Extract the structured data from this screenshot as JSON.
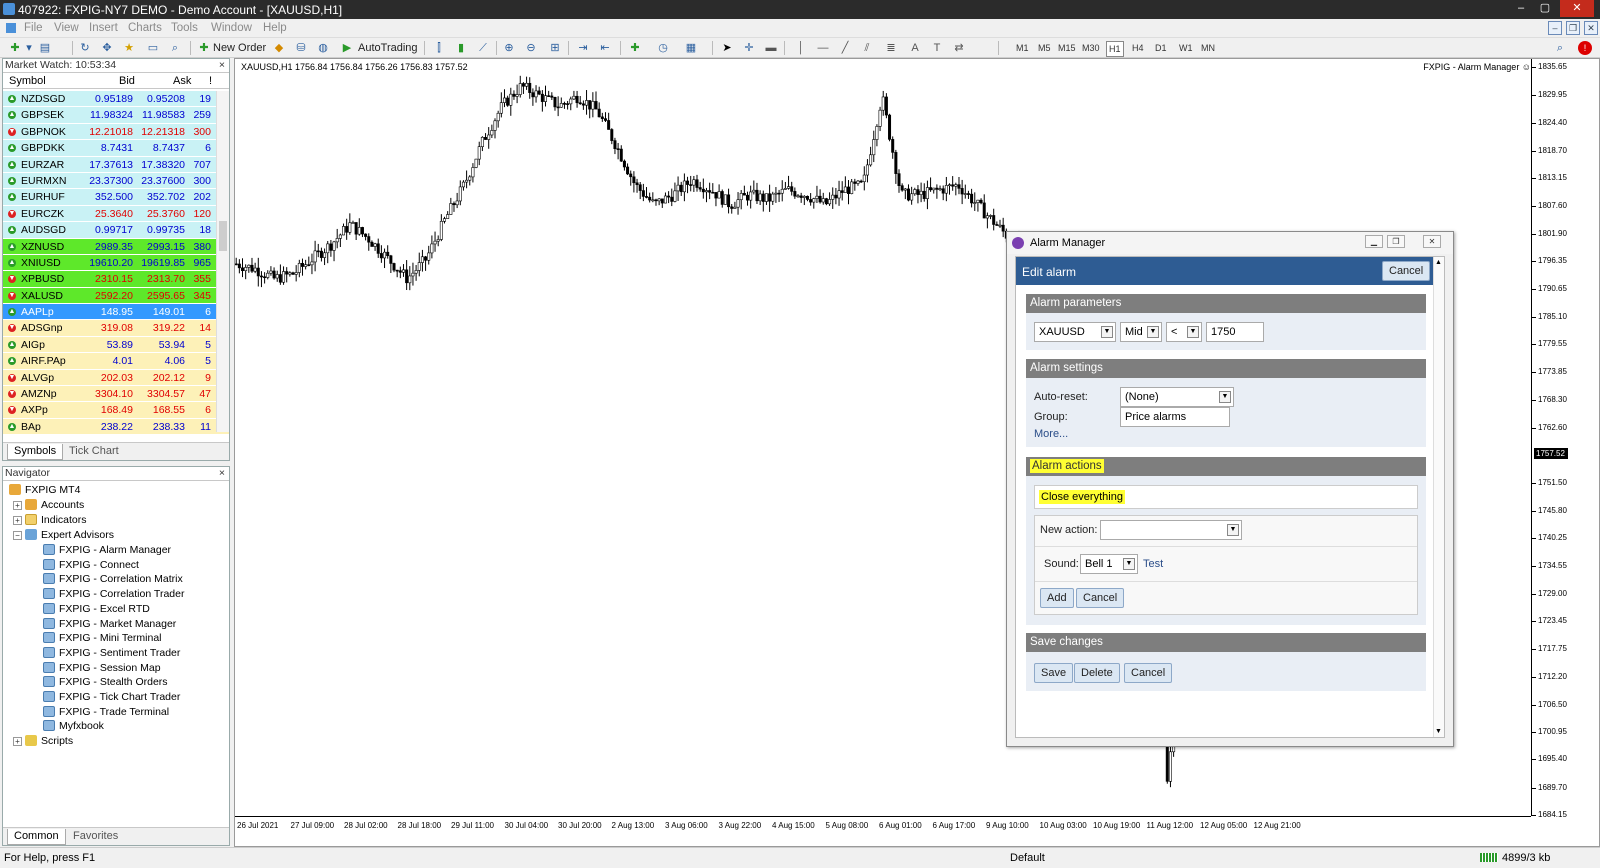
{
  "window": {
    "title": "407922: FXPIG-NY7 DEMO - Demo Account - [XAUUSD,H1]",
    "controls": [
      "–",
      "▢",
      "✕"
    ]
  },
  "menu": [
    "File",
    "View",
    "Insert",
    "Charts",
    "Tools",
    "Window",
    "Help"
  ],
  "toolbar": {
    "new_order": "New Order",
    "auto_trading": "AutoTrading",
    "timeframes": [
      "M1",
      "M5",
      "M15",
      "M30",
      "H1",
      "H4",
      "D1",
      "W1",
      "MN"
    ],
    "active_timeframe": "H1"
  },
  "market_watch": {
    "title": "Market Watch: 10:53:34",
    "columns": {
      "symbol": "Symbol",
      "bid": "Bid",
      "ask": "Ask",
      "spread": "!"
    },
    "rows": [
      {
        "symbol": "NZDSGD",
        "bid": "0.95189",
        "ask": "0.95208",
        "spread": "19",
        "bg": "#c9f2f5",
        "color": "#0000d0",
        "dir": "up"
      },
      {
        "symbol": "GBPSEK",
        "bid": "11.98324",
        "ask": "11.98583",
        "spread": "259",
        "bg": "#c9f2f5",
        "color": "#0000d0",
        "dir": "up"
      },
      {
        "symbol": "GBPNOK",
        "bid": "12.21018",
        "ask": "12.21318",
        "spread": "300",
        "bg": "#c9f2f5",
        "color": "#e00000",
        "dir": "down"
      },
      {
        "symbol": "GBPDKK",
        "bid": "8.7431",
        "ask": "8.7437",
        "spread": "6",
        "bg": "#c9f2f5",
        "color": "#0000d0",
        "dir": "up"
      },
      {
        "symbol": "EURZAR",
        "bid": "17.37613",
        "ask": "17.38320",
        "spread": "707",
        "bg": "#c9f2f5",
        "color": "#0000d0",
        "dir": "up"
      },
      {
        "symbol": "EURMXN",
        "bid": "23.37300",
        "ask": "23.37600",
        "spread": "300",
        "bg": "#c9f2f5",
        "color": "#0000d0",
        "dir": "up"
      },
      {
        "symbol": "EURHUF",
        "bid": "352.500",
        "ask": "352.702",
        "spread": "202",
        "bg": "#c9f2f5",
        "color": "#0000d0",
        "dir": "up"
      },
      {
        "symbol": "EURCZK",
        "bid": "25.3640",
        "ask": "25.3760",
        "spread": "120",
        "bg": "#c9f2f5",
        "color": "#e00000",
        "dir": "down"
      },
      {
        "symbol": "AUDSGD",
        "bid": "0.99717",
        "ask": "0.99735",
        "spread": "18",
        "bg": "#c9f2f5",
        "color": "#0000d0",
        "dir": "up"
      },
      {
        "symbol": "XZNUSD",
        "bid": "2989.35",
        "ask": "2993.15",
        "spread": "380",
        "bg": "#5ee82a",
        "color": "#0000d0",
        "dir": "up"
      },
      {
        "symbol": "XNIUSD",
        "bid": "19610.20",
        "ask": "19619.85",
        "spread": "965",
        "bg": "#5ee82a",
        "color": "#0000d0",
        "dir": "up"
      },
      {
        "symbol": "XPBUSD",
        "bid": "2310.15",
        "ask": "2313.70",
        "spread": "355",
        "bg": "#5ee82a",
        "color": "#e00000",
        "dir": "down"
      },
      {
        "symbol": "XALUSD",
        "bid": "2592.20",
        "ask": "2595.65",
        "spread": "345",
        "bg": "#5ee82a",
        "color": "#e00000",
        "dir": "down"
      },
      {
        "symbol": "AAPLp",
        "bid": "148.95",
        "ask": "149.01",
        "spread": "6",
        "bg": "#3399ff",
        "color": "#ffffff",
        "dir": "up"
      },
      {
        "symbol": "ADSGnp",
        "bid": "319.08",
        "ask": "319.22",
        "spread": "14",
        "bg": "#fdf1b8",
        "color": "#e00000",
        "dir": "down"
      },
      {
        "symbol": "AIGp",
        "bid": "53.89",
        "ask": "53.94",
        "spread": "5",
        "bg": "#fdf1b8",
        "color": "#0000d0",
        "dir": "up"
      },
      {
        "symbol": "AIRF.PAp",
        "bid": "4.01",
        "ask": "4.06",
        "spread": "5",
        "bg": "#fdf1b8",
        "color": "#0000d0",
        "dir": "up"
      },
      {
        "symbol": "ALVGp",
        "bid": "202.03",
        "ask": "202.12",
        "spread": "9",
        "bg": "#fdf1b8",
        "color": "#e00000",
        "dir": "down"
      },
      {
        "symbol": "AMZNp",
        "bid": "3304.10",
        "ask": "3304.57",
        "spread": "47",
        "bg": "#fdf1b8",
        "color": "#e00000",
        "dir": "down"
      },
      {
        "symbol": "AXPp",
        "bid": "168.49",
        "ask": "168.55",
        "spread": "6",
        "bg": "#fdf1b8",
        "color": "#e00000",
        "dir": "down"
      },
      {
        "symbol": "BAp",
        "bid": "238.22",
        "ask": "238.33",
        "spread": "11",
        "bg": "#fdf1b8",
        "color": "#0000d0",
        "dir": "up"
      }
    ],
    "tabs": [
      "Symbols",
      "Tick Chart"
    ]
  },
  "navigator": {
    "title": "Navigator",
    "root": "FXPIG MT4",
    "accounts": "Accounts",
    "indicators": "Indicators",
    "expert_advisors": "Expert Advisors",
    "experts": [
      "FXPIG - Alarm Manager",
      "FXPIG - Connect",
      "FXPIG - Correlation Matrix",
      "FXPIG - Correlation Trader",
      "FXPIG - Excel RTD",
      "FXPIG - Market Manager",
      "FXPIG - Mini Terminal",
      "FXPIG - Sentiment Trader",
      "FXPIG - Session Map",
      "FXPIG - Stealth Orders",
      "FXPIG - Tick Chart Trader",
      "FXPIG - Trade Terminal",
      "Myfxbook"
    ],
    "scripts": "Scripts",
    "tabs": [
      "Common",
      "Favorites"
    ]
  },
  "chart": {
    "header": "XAUUSD,H1  1756.84 1756.84 1756.26 1756.83 1757.52",
    "ea_label": "FXPIG - Alarm Manager ☺",
    "y_ticks": [
      "1835.65",
      "1829.95",
      "1824.40",
      "1818.70",
      "1813.15",
      "1807.60",
      "1801.90",
      "1796.35",
      "1790.65",
      "1785.10",
      "1779.55",
      "1773.85",
      "1768.30",
      "1762.60",
      "1757.52",
      "1751.50",
      "1745.80",
      "1740.25",
      "1734.55",
      "1729.00",
      "1723.45",
      "1717.75",
      "1712.20",
      "1706.50",
      "1700.95",
      "1695.40",
      "1689.70",
      "1684.15"
    ],
    "current_price": "1757.52",
    "x_ticks": [
      "26 Jul 2021",
      "27 Jul 09:00",
      "28 Jul 02:00",
      "28 Jul 18:00",
      "29 Jul 11:00",
      "30 Jul 04:00",
      "30 Jul 20:00",
      "2 Aug 13:00",
      "3 Aug 06:00",
      "3 Aug 22:00",
      "4 Aug 15:00",
      "5 Aug 08:00",
      "6 Aug 01:00",
      "6 Aug 17:00",
      "9 Aug 10:00",
      "10 Aug 03:00",
      "10 Aug 19:00",
      "11 Aug 12:00",
      "12 Aug 05:00",
      "12 Aug 21:00"
    ],
    "y_range": [
      1684.15,
      1837.5
    ]
  },
  "chart_data": {
    "type": "candlestick",
    "series": [
      {
        "name": "XAUUSD,H1",
        "close_path": [
          1796,
          1795,
          1793,
          1794,
          1797,
          1800,
          1804,
          1801,
          1797,
          1793,
          1797,
          1805,
          1812,
          1821,
          1828,
          1832,
          1830,
          1828,
          1830,
          1827,
          1820,
          1812,
          1808,
          1810,
          1813,
          1811,
          1808,
          1810,
          1809,
          1811,
          1810,
          1808,
          1811,
          1812,
          1830,
          1810,
          1810,
          1811,
          1812,
          1808,
          1804,
          1800,
          1798,
          1797,
          1795,
          1770,
          1763,
          1762,
          1763,
          1690,
          1735,
          1745,
          1745,
          1742
        ]
      }
    ]
  },
  "dialog": {
    "title": "Alarm Manager",
    "edit_title": "Edit alarm",
    "cancel_top": "Cancel",
    "sections": {
      "params": "Alarm parameters",
      "settings": "Alarm settings",
      "actions": "Alarm actions",
      "save": "Save changes"
    },
    "symbol": "XAUUSD",
    "price_type": "Mid",
    "operator": "<",
    "price": "1750",
    "auto_reset_label": "Auto-reset:",
    "auto_reset": "(None)",
    "group_label": "Group:",
    "group": "Price alarms",
    "more": "More...",
    "action_item": "Close everything",
    "new_action_label": "New action:",
    "new_action": "",
    "sound_label": "Sound:",
    "sound": "Bell 1",
    "test": "Test",
    "add": "Add",
    "cancel_action": "Cancel",
    "save": "Save",
    "delete": "Delete",
    "cancel_bottom": "Cancel"
  },
  "status": {
    "help": "For Help, press F1",
    "profile": "Default",
    "traffic": "4899/3 kb"
  }
}
